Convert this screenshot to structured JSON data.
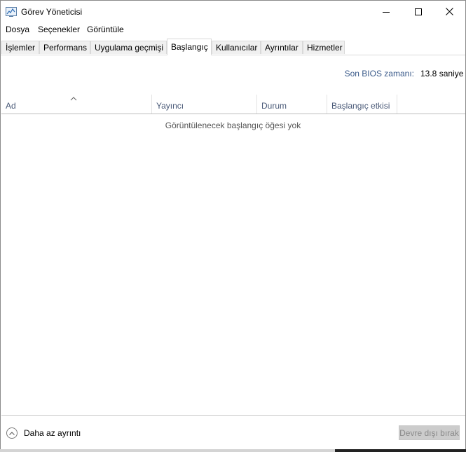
{
  "window": {
    "title": "Görev Yöneticisi",
    "minimize_label": "Simge durumuna küçült",
    "maximize_label": "Ekranı kapla",
    "close_label": "Kapat"
  },
  "menu": {
    "items": [
      "Dosya",
      "Seçenekler",
      "Görüntüle"
    ]
  },
  "tabs": {
    "items": [
      "İşlemler",
      "Performans",
      "Uygulama geçmişi",
      "Başlangıç",
      "Kullanıcılar",
      "Ayrıntılar",
      "Hizmetler"
    ],
    "active": "Başlangıç"
  },
  "bios": {
    "label": "Son BIOS zamanı:",
    "value": "13.8 saniye"
  },
  "table": {
    "columns": [
      "Ad",
      "Yayıncı",
      "Durum",
      "Başlangıç etkisi"
    ],
    "sort_column": "Ad",
    "empty_message": "Görüntülenecek başlangıç öğesi yok"
  },
  "footer": {
    "fewer_details": "Daha az ayrıntı",
    "disable_button": "Devre dışı bırak"
  },
  "colors": {
    "header_text": "#4a5a78",
    "bios_label": "#3a5a8a",
    "disabled_button_bg": "#cccccc"
  }
}
